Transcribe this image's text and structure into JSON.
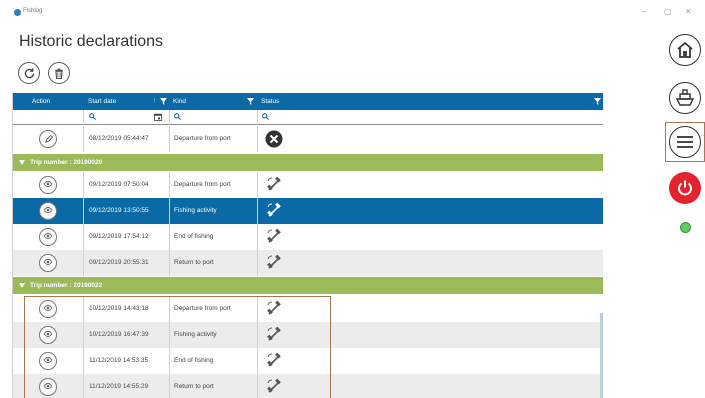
{
  "app": {
    "name": "Fishlog",
    "win_min": "–",
    "win_max": "▢",
    "win_close": "✕"
  },
  "page": {
    "title": "Historic declarations"
  },
  "toolbar": {
    "refresh_icon": "refresh-icon",
    "delete_icon": "trash-icon"
  },
  "grid": {
    "columns": {
      "action": "Action",
      "start_date": "Start date",
      "kind": "Kind",
      "status": "Status"
    },
    "first_row": {
      "date": "08/12/2019 05:44:47",
      "kind": "Departure from port",
      "status": "error"
    },
    "groups": [
      {
        "label": "Trip number : 20190020",
        "rows": [
          {
            "date": "09/12/2019 07:50:04",
            "kind": "Departure from port",
            "status": "satellite",
            "selected": false
          },
          {
            "date": "09/12/2019 13:50:55",
            "kind": "Fishing activity",
            "status": "satellite",
            "selected": true
          },
          {
            "date": "09/12/2019 17:54:12",
            "kind": "End of fishing",
            "status": "satellite",
            "selected": false
          },
          {
            "date": "09/12/2019 20:55:31",
            "kind": "Return to port",
            "status": "satellite",
            "selected": false
          }
        ]
      },
      {
        "label": "Trip number : 20190022",
        "rows": [
          {
            "date": "10/12/2019 14:43:18",
            "kind": "Departure from port",
            "status": "satellite",
            "selected": false
          },
          {
            "date": "10/12/2019 16:47:39",
            "kind": "Fishing activity",
            "status": "satellite",
            "selected": false
          },
          {
            "date": "11/12/2019 14:53:35",
            "kind": "End of fishing",
            "status": "satellite",
            "selected": false
          },
          {
            "date": "11/12/2019 14:55:29",
            "kind": "Return to port",
            "status": "satellite",
            "selected": false
          }
        ]
      }
    ]
  },
  "sidebar": {
    "items": [
      "home-icon",
      "ship-icon",
      "menu-icon",
      "power-icon"
    ],
    "connection_status_color": "#5fcf62"
  },
  "colors": {
    "header": "#0b6aa5",
    "group": "#9bba59",
    "selected": "#0b6aa5",
    "highlight": "#a87654",
    "power": "#e3232e"
  }
}
